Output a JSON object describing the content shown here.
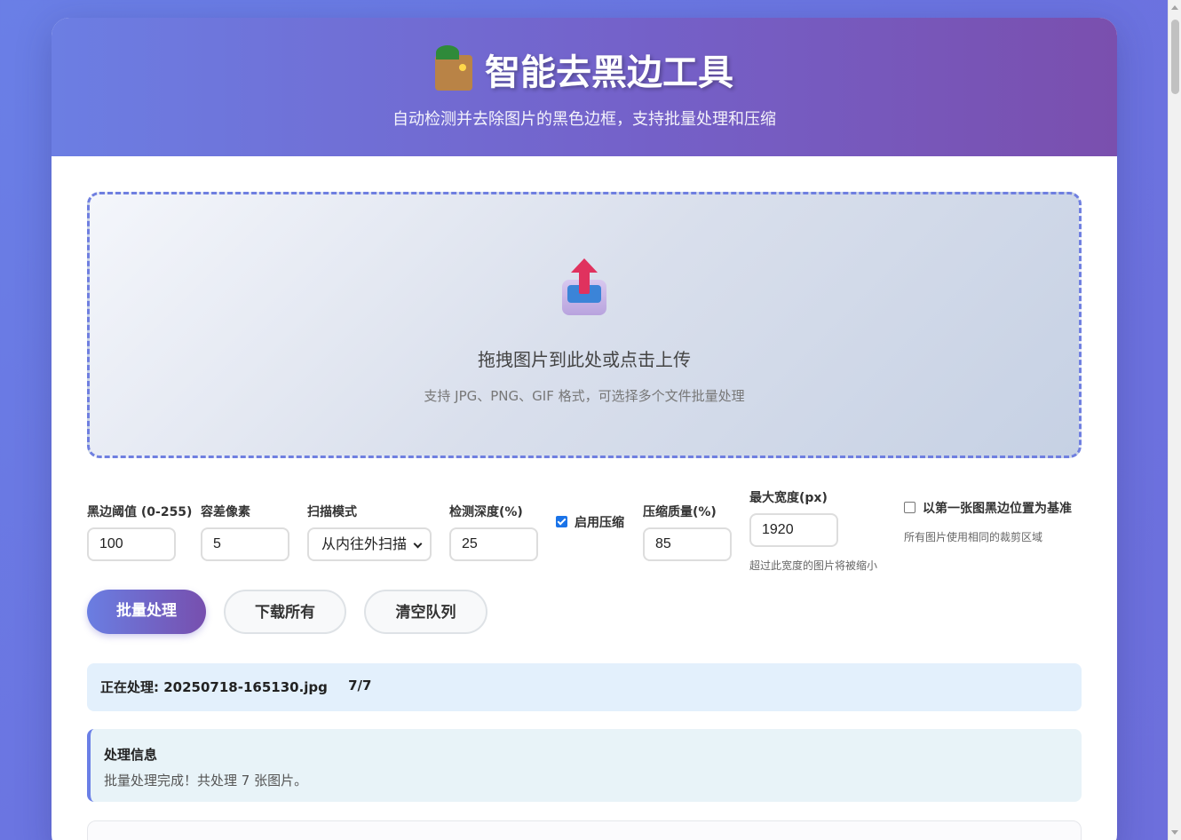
{
  "header": {
    "title": "智能去黑边工具",
    "subtitle": "自动检测并去除图片的黑色边框，支持批量处理和压缩"
  },
  "upload": {
    "title": "拖拽图片到此处或点击上传",
    "subtitle": "支持 JPG、PNG、GIF 格式，可选择多个文件批量处理"
  },
  "controls": {
    "threshold": {
      "label": "黑边阈值 (0-255)",
      "value": "100"
    },
    "tolerance": {
      "label": "容差像素",
      "value": "5"
    },
    "scan_mode": {
      "label": "扫描模式",
      "value": "从内往外扫描"
    },
    "depth": {
      "label": "检测深度(%)",
      "value": "25"
    },
    "compress": {
      "label": "启用压缩",
      "checked": true
    },
    "quality": {
      "label": "压缩质量(%)",
      "value": "85"
    },
    "max_width": {
      "label": "最大宽度(px)",
      "value": "1920",
      "hint": "超过此宽度的图片将被缩小"
    },
    "baseline": {
      "label": "以第一张图黑边位置为基准",
      "checked": false,
      "hint": "所有图片使用相同的裁剪区域"
    }
  },
  "buttons": {
    "batch": "批量处理",
    "download": "下载所有",
    "clear": "清空队列"
  },
  "progress": {
    "text": "正在处理: 20250718-165130.jpg",
    "count": "7/7"
  },
  "info": {
    "title": "处理信息",
    "message": "批量处理完成！共处理 7 张图片。"
  },
  "colors": {
    "accent": "#6a7fe6",
    "accent_end": "#774fae",
    "checkbox_on": "#1a73e8"
  }
}
